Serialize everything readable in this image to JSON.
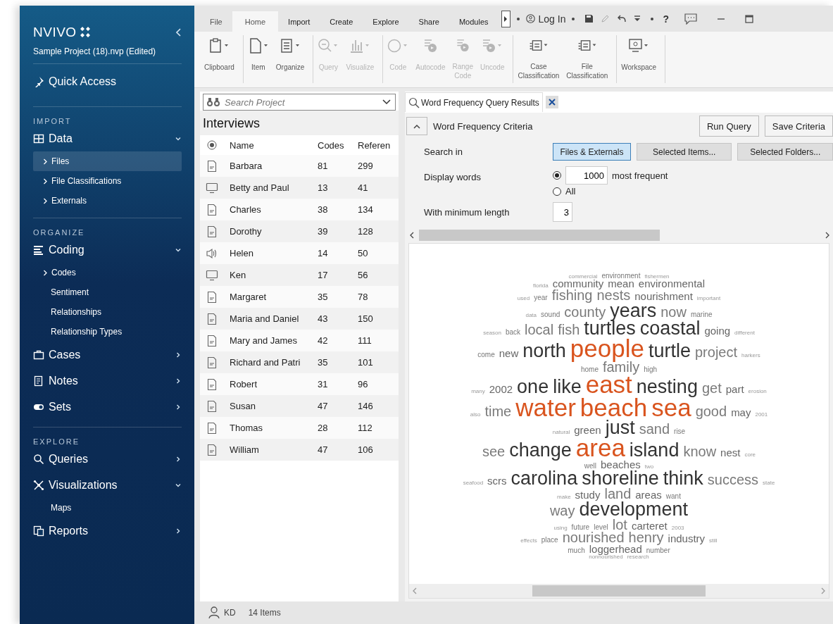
{
  "sidebar": {
    "logo": "NVIVO",
    "project": "Sample Project (18).nvp (Edited)",
    "quick_access": "Quick Access",
    "sections": [
      {
        "heading": "IMPORT",
        "groups": [
          {
            "label": "Data",
            "expanded": true,
            "children": [
              {
                "label": "Files",
                "expandable": true,
                "selected": true
              },
              {
                "label": "File Classifications",
                "expandable": true,
                "selected": false
              },
              {
                "label": "Externals",
                "expandable": true,
                "selected": false
              }
            ]
          }
        ]
      },
      {
        "heading": "ORGANIZE",
        "groups": [
          {
            "label": "Coding",
            "expanded": true,
            "children": [
              {
                "label": "Codes",
                "expandable": true,
                "selected": false
              },
              {
                "label": "Sentiment",
                "expandable": false,
                "selected": false
              },
              {
                "label": "Relationships",
                "expandable": false,
                "selected": false
              },
              {
                "label": "Relationship Types",
                "expandable": false,
                "selected": false
              }
            ]
          },
          {
            "label": "Cases",
            "expanded": false
          },
          {
            "label": "Notes",
            "expanded": false
          },
          {
            "label": "Sets",
            "expanded": false
          }
        ]
      },
      {
        "heading": "EXPLORE",
        "groups": [
          {
            "label": "Queries",
            "expanded": false
          },
          {
            "label": "Visualizations",
            "expanded": true,
            "children": [
              {
                "label": "Maps",
                "expandable": false,
                "selected": false
              }
            ]
          },
          {
            "label": "Reports",
            "expanded": false
          }
        ]
      }
    ]
  },
  "ribbon": {
    "tabs": [
      {
        "label": "File",
        "selected": false
      },
      {
        "label": "Home",
        "selected": true
      },
      {
        "label": "Import",
        "selected": false
      },
      {
        "label": "Create",
        "selected": false
      },
      {
        "label": "Explore",
        "selected": false
      },
      {
        "label": "Share",
        "selected": false
      },
      {
        "label": "Modules",
        "selected": false
      }
    ],
    "login": "Log In",
    "help": "?",
    "groups": [
      {
        "buttons": [
          {
            "label": "Clipboard",
            "disabled": false
          }
        ]
      },
      {
        "buttons": [
          {
            "label": "Item",
            "disabled": false
          },
          {
            "label": "Organize",
            "disabled": false
          }
        ]
      },
      {
        "buttons": [
          {
            "label": "Query",
            "disabled": true
          },
          {
            "label": "Visualize",
            "disabled": true
          }
        ]
      },
      {
        "buttons": [
          {
            "label": "Code",
            "disabled": true
          },
          {
            "label": "Autocode",
            "disabled": true
          },
          {
            "label": "Range Code",
            "disabled": true
          },
          {
            "label": "Uncode",
            "disabled": true
          }
        ]
      },
      {
        "buttons": [
          {
            "label": "Case Classification",
            "disabled": false
          },
          {
            "label": "File Classification",
            "disabled": false
          }
        ]
      },
      {
        "buttons": [
          {
            "label": "Workspace",
            "disabled": false
          }
        ]
      }
    ]
  },
  "list_panel": {
    "search": {
      "placeholder": "Search Project"
    },
    "title": "Interviews",
    "columns": [
      "Name",
      "Codes",
      "Referen"
    ],
    "rows": [
      {
        "kind": "document",
        "name": "Barbara",
        "codes": "81",
        "references": "299"
      },
      {
        "kind": "video",
        "name": "Betty and Paul",
        "codes": "13",
        "references": "41"
      },
      {
        "kind": "document",
        "name": "Charles",
        "codes": "38",
        "references": "134"
      },
      {
        "kind": "document",
        "name": "Dorothy",
        "codes": "39",
        "references": "128"
      },
      {
        "kind": "audio",
        "name": "Helen",
        "codes": "14",
        "references": "50"
      },
      {
        "kind": "video",
        "name": "Ken",
        "codes": "17",
        "references": "56"
      },
      {
        "kind": "document",
        "name": "Margaret",
        "codes": "35",
        "references": "78"
      },
      {
        "kind": "document",
        "name": "Maria and Daniel",
        "codes": "43",
        "references": "150"
      },
      {
        "kind": "document",
        "name": "Mary and James",
        "codes": "42",
        "references": "111"
      },
      {
        "kind": "document",
        "name": "Richard and Patri",
        "codes": "35",
        "references": "101"
      },
      {
        "kind": "document",
        "name": "Robert",
        "codes": "31",
        "references": "96"
      },
      {
        "kind": "document",
        "name": "Susan",
        "codes": "47",
        "references": "146"
      },
      {
        "kind": "document",
        "name": "Thomas",
        "codes": "28",
        "references": "112"
      },
      {
        "kind": "document",
        "name": "William",
        "codes": "47",
        "references": "106"
      }
    ]
  },
  "detail": {
    "tab": {
      "label": "Word Frequency Query Results",
      "selected": true
    },
    "criteria": {
      "title": "Word Frequency Criteria",
      "expanded": true,
      "actions": [
        "Run Query",
        "Save Criteria"
      ],
      "search_in_label": "Search in",
      "search_in": [
        {
          "label": "Files & Externals",
          "selected": true
        },
        {
          "label": "Selected Items...",
          "selected": false
        },
        {
          "label": "Selected Folders...",
          "selected": false
        }
      ],
      "display_label": "Display words",
      "display_options": [
        {
          "kind": "count",
          "selected": true,
          "value": "1000",
          "suffix": "most frequent"
        },
        {
          "kind": "all",
          "selected": false,
          "label": "All"
        }
      ],
      "min_length_label": "With minimum length",
      "min_length": "3"
    },
    "word_cloud": {
      "lines": [
        {
          "words": [
            {
              "text": "commercial",
              "kind": "tiny"
            },
            {
              "text": "environment",
              "kind": "low"
            },
            {
              "text": "fishermen",
              "kind": "tiny"
            }
          ]
        },
        {
          "words": [
            {
              "text": "florida",
              "kind": "tiny"
            },
            {
              "text": "community",
              "kind": "minor"
            },
            {
              "text": "mean",
              "kind": "minor"
            },
            {
              "text": "environmental",
              "kind": "minor"
            }
          ]
        },
        {
          "words": [
            {
              "text": "used",
              "kind": "tiny"
            },
            {
              "text": "year",
              "kind": "low"
            },
            {
              "text": "fishing",
              "kind": "mid"
            },
            {
              "text": "nests",
              "kind": "mid"
            },
            {
              "text": "nourishment",
              "kind": "minor"
            },
            {
              "text": "important",
              "kind": "tiny"
            }
          ]
        },
        {
          "words": [
            {
              "text": "data",
              "kind": "tiny"
            },
            {
              "text": "sound",
              "kind": "low"
            },
            {
              "text": "county",
              "kind": "mid"
            },
            {
              "text": "years",
              "kind": "major"
            },
            {
              "text": "now",
              "kind": "mid"
            },
            {
              "text": "marine",
              "kind": "low"
            }
          ]
        },
        {
          "words": [
            {
              "text": "season",
              "kind": "tiny"
            },
            {
              "text": "back",
              "kind": "low"
            },
            {
              "text": "local",
              "kind": "mid"
            },
            {
              "text": "fish",
              "kind": "mid"
            },
            {
              "text": "turtles",
              "kind": "major"
            },
            {
              "text": "coastal",
              "kind": "major"
            },
            {
              "text": "going",
              "kind": "minor"
            },
            {
              "text": "different",
              "kind": "tiny"
            }
          ]
        },
        {
          "words": [
            {
              "text": "come",
              "kind": "low"
            },
            {
              "text": "new",
              "kind": "minor"
            },
            {
              "text": "north",
              "kind": "major"
            },
            {
              "text": "people",
              "kind": "top"
            },
            {
              "text": "turtle",
              "kind": "major"
            },
            {
              "text": "project",
              "kind": "mid"
            },
            {
              "text": "harkers",
              "kind": "tiny"
            }
          ]
        },
        {
          "words": [
            {
              "text": "home",
              "kind": "low"
            },
            {
              "text": "family",
              "kind": "mid"
            },
            {
              "text": "high",
              "kind": "low"
            }
          ]
        },
        {
          "words": [
            {
              "text": "many",
              "kind": "tiny"
            },
            {
              "text": "2002",
              "kind": "minor"
            },
            {
              "text": "one",
              "kind": "major"
            },
            {
              "text": "like",
              "kind": "major"
            },
            {
              "text": "east",
              "kind": "top"
            },
            {
              "text": "nesting",
              "kind": "major"
            },
            {
              "text": "get",
              "kind": "mid"
            },
            {
              "text": "part",
              "kind": "minor"
            },
            {
              "text": "erosion",
              "kind": "tiny"
            }
          ]
        },
        {
          "words": [
            {
              "text": "also",
              "kind": "tiny"
            },
            {
              "text": "time",
              "kind": "mid"
            },
            {
              "text": "water",
              "kind": "top"
            },
            {
              "text": "beach",
              "kind": "top"
            },
            {
              "text": "sea",
              "kind": "top"
            },
            {
              "text": "good",
              "kind": "mid"
            },
            {
              "text": "may",
              "kind": "minor"
            },
            {
              "text": "2001",
              "kind": "tiny"
            }
          ]
        },
        {
          "words": [
            {
              "text": "natural",
              "kind": "tiny"
            },
            {
              "text": "green",
              "kind": "minor"
            },
            {
              "text": "just",
              "kind": "major"
            },
            {
              "text": "sand",
              "kind": "mid"
            },
            {
              "text": "rise",
              "kind": "low"
            }
          ]
        },
        {
          "words": [
            {
              "text": "see",
              "kind": "mid"
            },
            {
              "text": "change",
              "kind": "major"
            },
            {
              "text": "area",
              "kind": "top"
            },
            {
              "text": "island",
              "kind": "major"
            },
            {
              "text": "know",
              "kind": "mid"
            },
            {
              "text": "nest",
              "kind": "minor"
            },
            {
              "text": "core",
              "kind": "tiny"
            }
          ]
        },
        {
          "words": [
            {
              "text": "well",
              "kind": "low"
            },
            {
              "text": "beaches",
              "kind": "minor"
            },
            {
              "text": "two",
              "kind": "tiny"
            }
          ]
        },
        {
          "words": [
            {
              "text": "seafood",
              "kind": "tiny"
            },
            {
              "text": "scrs",
              "kind": "minor"
            },
            {
              "text": "carolina",
              "kind": "major"
            },
            {
              "text": "shoreline",
              "kind": "major"
            },
            {
              "text": "think",
              "kind": "major"
            },
            {
              "text": "success",
              "kind": "mid"
            },
            {
              "text": "state",
              "kind": "tiny"
            }
          ]
        },
        {
          "words": [
            {
              "text": "make",
              "kind": "tiny"
            },
            {
              "text": "study",
              "kind": "minor"
            },
            {
              "text": "land",
              "kind": "mid"
            },
            {
              "text": "areas",
              "kind": "minor"
            },
            {
              "text": "want",
              "kind": "low"
            }
          ]
        },
        {
          "words": [
            {
              "text": "way",
              "kind": "mid"
            },
            {
              "text": "development",
              "kind": "major"
            }
          ]
        },
        {
          "words": [
            {
              "text": "using",
              "kind": "tiny"
            },
            {
              "text": "future",
              "kind": "low"
            },
            {
              "text": "level",
              "kind": "low"
            },
            {
              "text": "lot",
              "kind": "mid"
            },
            {
              "text": "carteret",
              "kind": "minor"
            },
            {
              "text": "2003",
              "kind": "tiny"
            }
          ]
        },
        {
          "words": [
            {
              "text": "effects",
              "kind": "tiny"
            },
            {
              "text": "place",
              "kind": "low"
            },
            {
              "text": "nourished",
              "kind": "mid"
            },
            {
              "text": "henry",
              "kind": "mid"
            },
            {
              "text": "industry",
              "kind": "minor"
            },
            {
              "text": "still",
              "kind": "tiny"
            }
          ]
        },
        {
          "words": [
            {
              "text": "much",
              "kind": "low"
            },
            {
              "text": "loggerhead",
              "kind": "minor"
            },
            {
              "text": "number",
              "kind": "low"
            }
          ]
        },
        {
          "words": [
            {
              "text": "nonnourished",
              "kind": "tiny"
            },
            {
              "text": "research",
              "kind": "tiny"
            }
          ]
        }
      ]
    }
  },
  "status_bar": {
    "user": "KD",
    "count": "14 Items"
  }
}
